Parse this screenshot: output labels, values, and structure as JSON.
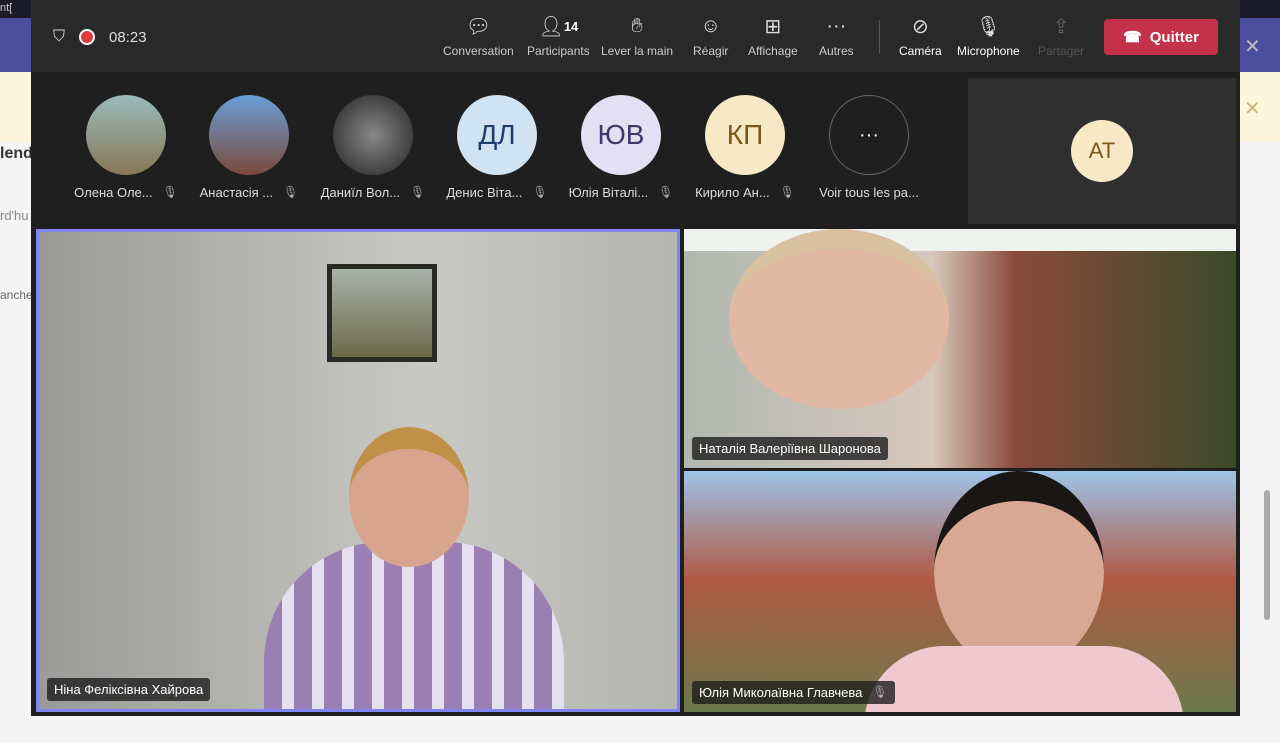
{
  "background": {
    "frag1": "nt[",
    "frag2": "lend",
    "frag3": "rd'hu",
    "frag4": "anche"
  },
  "toolbar": {
    "timer": "08:23",
    "participant_count": "14",
    "buttons": [
      {
        "label": "Conversation"
      },
      {
        "label": "Participants"
      },
      {
        "label": "Lever la main"
      },
      {
        "label": "Réagir"
      },
      {
        "label": "Affichage"
      },
      {
        "label": "Autres"
      },
      {
        "label": "Caméra"
      },
      {
        "label": "Microphone"
      },
      {
        "label": "Partager"
      }
    ],
    "quit_label": "Quitter"
  },
  "participants": [
    {
      "name": "Олена Оле...",
      "initials": ""
    },
    {
      "name": "Анастасія ...",
      "initials": ""
    },
    {
      "name": "Даниїл Вол...",
      "initials": ""
    },
    {
      "name": "Денис Віта...",
      "initials": "ДЛ"
    },
    {
      "name": "Юлія Віталі...",
      "initials": "ЮВ"
    },
    {
      "name": "Кирило Ан...",
      "initials": "КП"
    }
  ],
  "see_all": "Voir tous les pa...",
  "side_tile": {
    "initials": "AT"
  },
  "videos": [
    {
      "name": "Ніна Феліксівна Хайрова"
    },
    {
      "name": "Наталія Валеріївна Шаронова"
    },
    {
      "name": "Юлія Миколаївна Главчева"
    }
  ],
  "colors": {
    "accent": "#7f85f5",
    "quit": "#c4314b"
  }
}
